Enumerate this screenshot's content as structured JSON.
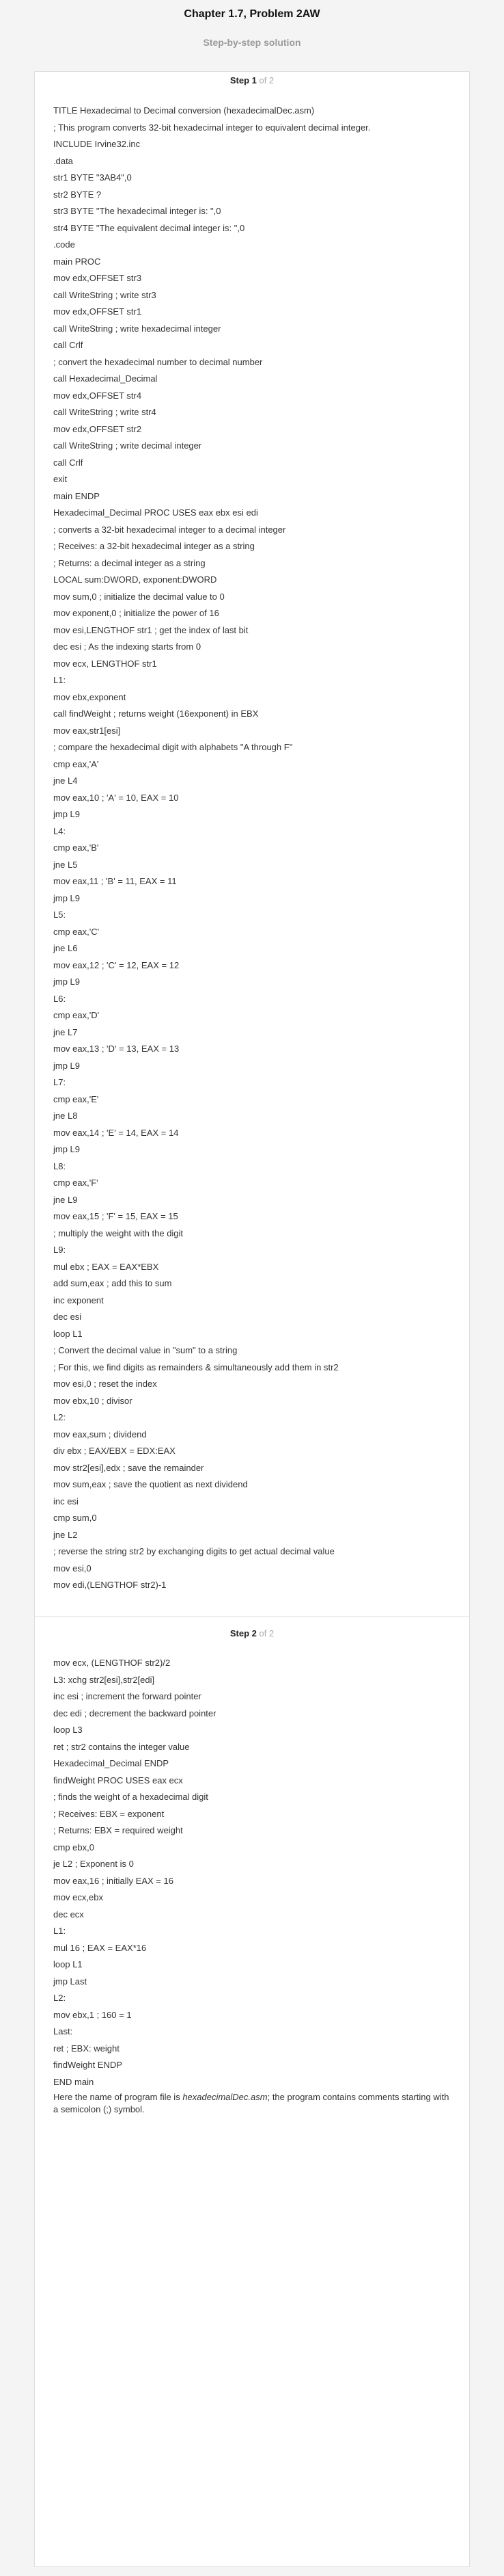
{
  "header": {
    "title": "Chapter 1.7, Problem 2AW",
    "subtitle": "Step-by-step solution"
  },
  "steps": [
    {
      "label": "Step",
      "number": "1",
      "total": "of 2",
      "lines": [
        "TITLE Hexadecimal to Decimal conversion (hexadecimalDec.asm)",
        "; This program converts 32-bit hexadecimal integer to equivalent decimal integer.",
        "INCLUDE Irvine32.inc",
        ".data",
        "str1 BYTE \"3AB4\",0",
        "str2 BYTE ?",
        "str3 BYTE \"The hexadecimal integer is: \",0",
        "str4 BYTE \"The equivalent decimal integer is: \",0",
        ".code",
        "main PROC",
        "mov edx,OFFSET str3",
        "call WriteString ; write str3",
        "mov edx,OFFSET str1",
        "call WriteString ; write hexadecimal integer",
        "call Crlf",
        "; convert the hexadecimal number to decimal number",
        "call Hexadecimal_Decimal",
        "mov edx,OFFSET str4",
        "call WriteString ; write str4",
        "mov edx,OFFSET str2",
        "call WriteString ; write decimal integer",
        "call Crlf",
        "exit",
        "main ENDP",
        "Hexadecimal_Decimal PROC USES eax ebx esi edi",
        "; converts a 32-bit hexadecimal integer to a decimal integer",
        "; Receives: a 32-bit hexadecimal integer as a string",
        "; Returns: a decimal integer as a string",
        "LOCAL sum:DWORD, exponent:DWORD",
        "mov sum,0 ; initialize the decimal value to 0",
        "mov exponent,0 ; initialize the power of 16",
        "mov esi,LENGTHOF str1 ; get the index of last bit",
        "dec esi ; As the indexing starts from 0",
        "mov ecx, LENGTHOF str1",
        "L1:",
        "mov ebx,exponent",
        "call findWeight ; returns weight (16exponent) in EBX",
        "mov eax,str1[esi]",
        "; compare the hexadecimal digit with alphabets \"A through F\"",
        "cmp eax,'A'",
        "jne L4",
        "mov eax,10 ; 'A' = 10, EAX = 10",
        "jmp L9",
        "L4:",
        "cmp eax,'B'",
        "jne L5",
        "mov eax,11 ; 'B' = 11, EAX = 11",
        "jmp L9",
        "L5:",
        "cmp eax,'C'",
        "jne L6",
        "mov eax,12 ; 'C' = 12, EAX = 12",
        "jmp L9",
        "L6:",
        "cmp eax,'D'",
        "jne L7",
        "mov eax,13 ; 'D' = 13, EAX = 13",
        "jmp L9",
        "L7:",
        "cmp eax,'E'",
        "jne L8",
        "mov eax,14 ; 'E' = 14, EAX = 14",
        "jmp L9",
        "L8:",
        "cmp eax,'F'",
        "jne L9",
        "mov eax,15 ; 'F' = 15, EAX = 15",
        "; multiply the weight with the digit",
        "L9:",
        "mul ebx ; EAX = EAX*EBX",
        "add sum,eax ; add this to sum",
        "inc exponent",
        "dec esi",
        "loop L1",
        "; Convert the decimal value in \"sum\" to a string",
        "; For this, we find digits as remainders & simultaneously add them in str2",
        "mov esi,0 ; reset the index",
        "mov ebx,10 ; divisor",
        "L2:",
        "mov eax,sum ; dividend",
        "div ebx ; EAX/EBX = EDX:EAX",
        "mov str2[esi],edx ; save the remainder",
        "mov sum,eax ; save the quotient as next dividend",
        "inc esi",
        "cmp sum,0",
        "jne L2",
        "; reverse the string str2 by exchanging digits to get actual decimal value",
        "mov esi,0",
        "mov edi,(LENGTHOF str2)-1"
      ]
    },
    {
      "label": "Step",
      "number": "2",
      "total": "of 2",
      "lines": [
        "mov ecx, (LENGTHOF str2)/2",
        "L3: xchg str2[esi],str2[edi]",
        "inc esi ; increment the forward pointer",
        "dec edi ; decrement the backward pointer",
        "loop L3",
        "ret ; str2 contains the integer value",
        "Hexadecimal_Decimal ENDP",
        "findWeight PROC USES eax ecx",
        "; finds the weight of a hexadecimal digit",
        "; Receives: EBX = exponent",
        "; Returns: EBX = required weight",
        "cmp ebx,0",
        "je L2 ; Exponent is 0",
        "mov eax,16 ; initially EAX = 16",
        "mov ecx,ebx",
        "dec ecx",
        "L1:",
        "mul 16 ; EAX = EAX*16",
        "loop L1",
        "jmp Last",
        "L2:",
        "mov ebx,1 ; 160 = 1",
        "Last:",
        "ret ; EBX: weight",
        "findWeight ENDP",
        "END main"
      ],
      "note": {
        "before": "Here the name of program file is ",
        "filename": "hexadecimalDec.asm",
        "after": "; the program contains comments starting with a semicolon (;) symbol."
      }
    }
  ]
}
